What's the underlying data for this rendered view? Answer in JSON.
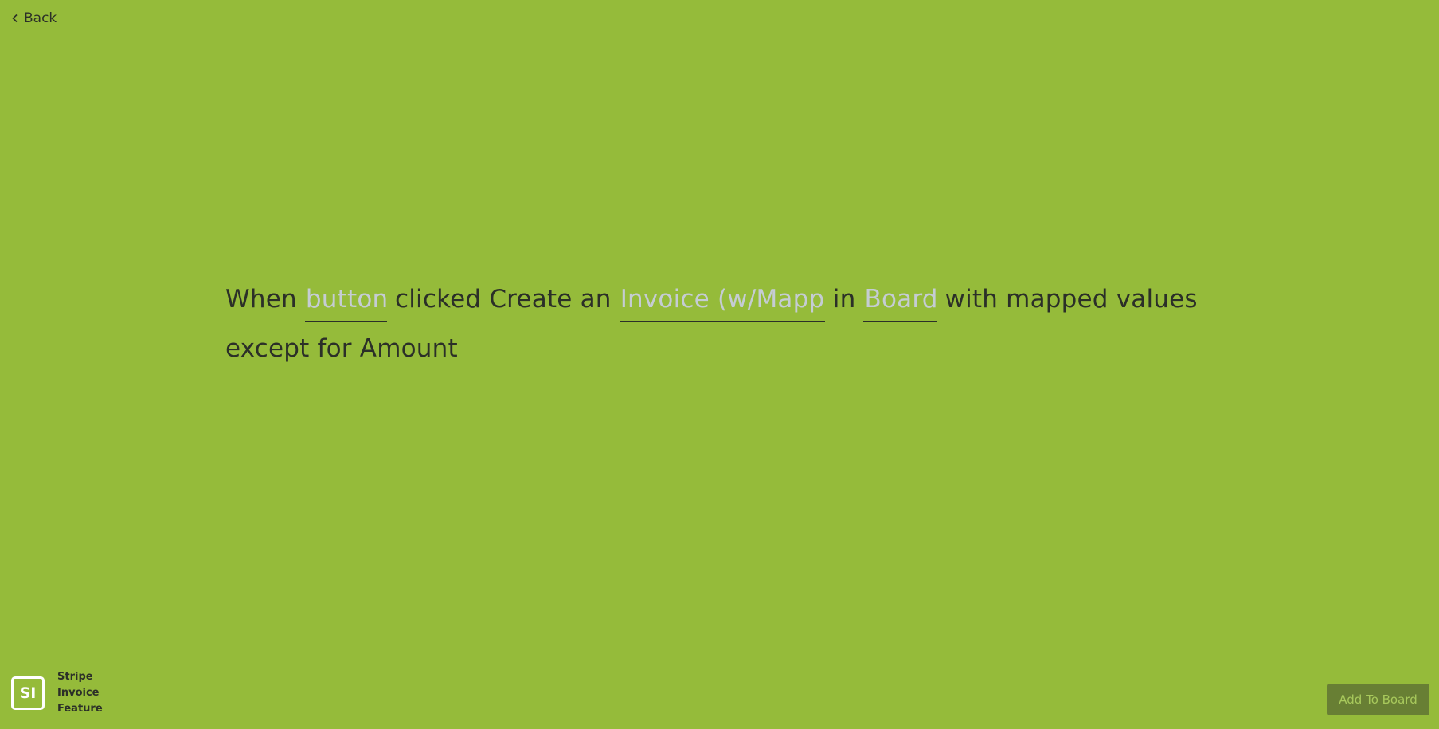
{
  "nav": {
    "back_label": "Back",
    "back_icon": "chevron-left-icon"
  },
  "sentence": {
    "part_when": "When",
    "trigger_placeholder": "button",
    "part_clicked": "clicked Create an",
    "object_placeholder": "Invoice (w/Mapped values)",
    "part_in": "in",
    "board_placeholder": "Board",
    "part_rest": "with mapped values except for Amount"
  },
  "app": {
    "icon_text": "SI",
    "name": "Stripe Invoice Feature"
  },
  "actions": {
    "add_to_board_label": "Add To Board"
  },
  "colors": {
    "background": "#95bb3a",
    "text": "#2b2f28",
    "placeholder": "#c5ccd4",
    "button_bg": "#687f34",
    "button_text": "#a8c95c"
  }
}
